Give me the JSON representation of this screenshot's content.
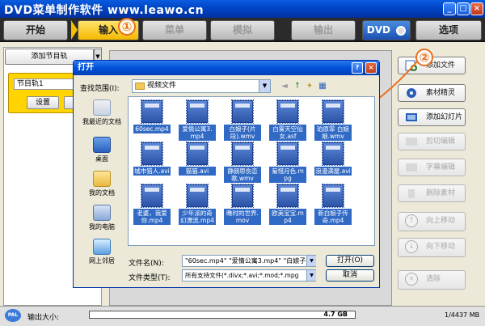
{
  "app": {
    "title": "DVD菜单制作软件 www.leawo.cn"
  },
  "tabs": [
    {
      "label": "开始",
      "state": "normal"
    },
    {
      "label": "输入",
      "state": "active"
    },
    {
      "label": "菜单",
      "state": "disabled"
    },
    {
      "label": "模拟",
      "state": "disabled"
    },
    {
      "label": "输出",
      "state": "disabled"
    },
    {
      "label": "DVD",
      "state": "logo"
    },
    {
      "label": "选项",
      "state": "normal"
    }
  ],
  "left_panel": {
    "add_track_label": "添加节目轨",
    "track_name": "节目轨1",
    "settings_label": "设置"
  },
  "right_buttons": [
    {
      "label": "添加文件",
      "enabled": true,
      "icon": "add-file-icon"
    },
    {
      "label": "素材精灵",
      "enabled": true,
      "icon": "wizard-icon"
    },
    {
      "label": "添加幻灯片",
      "enabled": true,
      "icon": "slideshow-icon"
    },
    {
      "label": "剪切编辑",
      "enabled": false,
      "icon": "scissors-icon"
    },
    {
      "label": "字幕编辑",
      "enabled": false,
      "icon": "subtitle-icon"
    },
    {
      "label": "删除素材",
      "enabled": false,
      "icon": "trash-icon"
    },
    {
      "label": "向上移动",
      "enabled": false,
      "icon": "up-arrow-icon"
    },
    {
      "label": "向下移动",
      "enabled": false,
      "icon": "down-arrow-icon"
    },
    {
      "label": "清除",
      "enabled": false,
      "icon": "clear-icon"
    }
  ],
  "status": {
    "format": "PAL",
    "output_size_label": "输出大小:",
    "disc_size": "4.7 GB",
    "ratio": "1/4437 MB"
  },
  "dialog": {
    "title": "打开",
    "look_in_label": "查找范围(I):",
    "look_in_value": "视频文件",
    "places": [
      "我最近的文档",
      "桌面",
      "我的文档",
      "我的电脑",
      "网上邻居"
    ],
    "files": [
      {
        "name": "60sec.mp4",
        "tag": "MP4"
      },
      {
        "name": "爱情公寓3.mp4",
        "tag": "MP4"
      },
      {
        "name": "白娘子(片段).wmv",
        "tag": "WMV"
      },
      {
        "name": "白雾天空仙女.asf",
        "tag": "WMV"
      },
      {
        "name": "珀原霏 白娘娘.wmv",
        "tag": "WMV"
      },
      {
        "name": "城市猎人.avi",
        "tag": "AVI"
      },
      {
        "name": "猫猫.avi",
        "tag": "AVI"
      },
      {
        "name": "静朗思伤恋歌.wmv",
        "tag": "WMV"
      },
      {
        "name": "菊惜月色.mpg",
        "tag": "MPG"
      },
      {
        "name": "浪漫满屋.avi",
        "tag": "AVI"
      },
      {
        "name": "老婆，我爱你.mp4",
        "tag": "MP4"
      },
      {
        "name": "少年派的奇幻漂流.mp4",
        "tag": "MP4"
      },
      {
        "name": "瞧时的世界.mov",
        "tag": "MOV"
      },
      {
        "name": "欧美宝宝.mp4",
        "tag": "MP4"
      },
      {
        "name": "新白娘子传奇.mp4",
        "tag": "MP4"
      }
    ],
    "filename_label": "文件名(N):",
    "filename_value": "\"60sec.mp4\" \"爱情公寓3.mp4\" \"白娘子(片",
    "filetype_label": "文件类型(T):",
    "filetype_value": "所有支持文件(*.divx;*.avi;*.mod;*.mpg",
    "open_label": "打开(O)",
    "cancel_label": "取消"
  },
  "callouts": [
    "①",
    "②"
  ],
  "colors": {
    "accent": "#f5b800",
    "selection": "#316ac5",
    "callout": "#e87020"
  }
}
